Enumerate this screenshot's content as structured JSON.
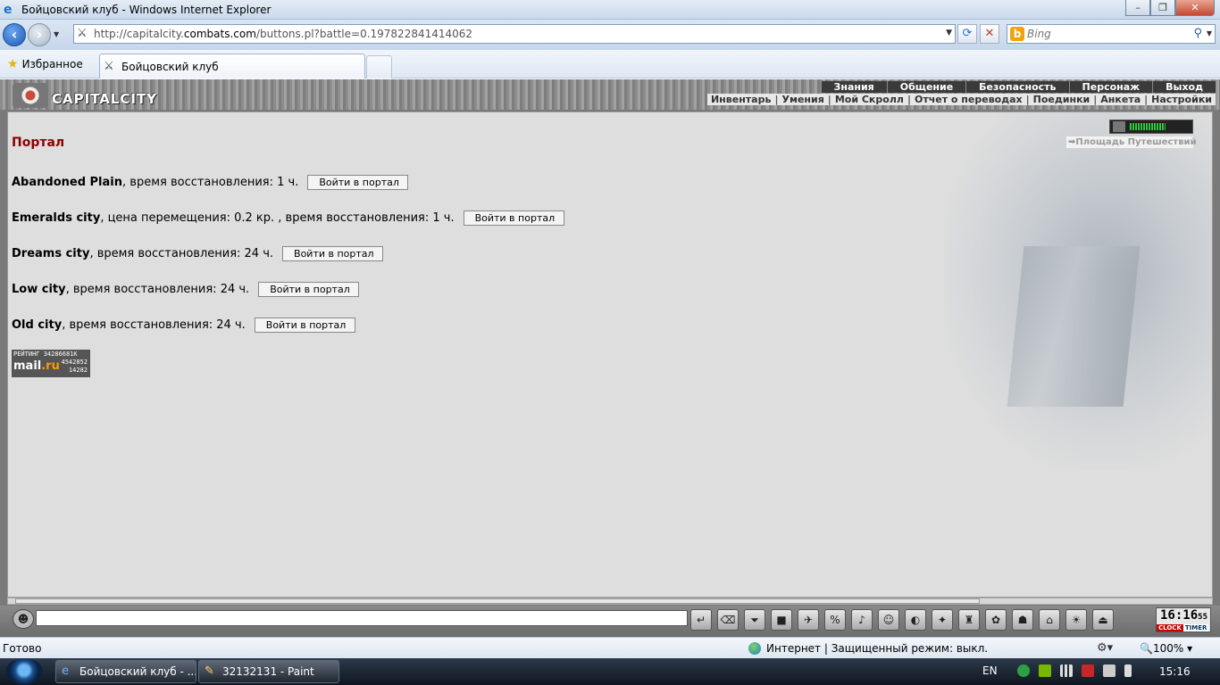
{
  "window": {
    "title": "Бойцовский клуб - Windows Internet Explorer",
    "buttons": [
      "–",
      "❐",
      "✕"
    ]
  },
  "address": {
    "url_prefix": "http://capitalcity.",
    "url_domain": "combats.com",
    "url_suffix": "/buttons.pl?battle=0.197822841414062",
    "search_placeholder": "Bing"
  },
  "tabs": {
    "favorites_label": "Избранное",
    "active_tab_label": "Бойцовский клуб"
  },
  "game": {
    "logo_text": "CAPITALCITY",
    "top_menu": [
      "Знания",
      "Общение",
      "Безопасность",
      "Персонаж",
      "Выход"
    ],
    "sub_menu": [
      "Инвентарь",
      "Умения",
      "Мой Скролл",
      "Отчет о переводах",
      "Поединки",
      "Анкета",
      "Настройки"
    ],
    "travel_link": "Площадь Путешествий"
  },
  "portal": {
    "title": "Портал",
    "button_label": "Войти в портал",
    "destinations": [
      {
        "name": "Abandoned Plain",
        "details": ", время восстановления: 1 ч."
      },
      {
        "name": "Emeralds city",
        "details": ", цена перемещения: 0.2 кр. , время восстановления: 1 ч."
      },
      {
        "name": "Dreams city",
        "details": ", время восстановления: 24 ч."
      },
      {
        "name": "Low city",
        "details": ", время восстановления: 24 ч."
      },
      {
        "name": "Old city",
        "details": ", время восстановления: 24 ч."
      }
    ]
  },
  "counter": {
    "header": "РЕЙТИНГ 34286681K",
    "brand_a": "mail",
    "brand_b": ".ru",
    "n1": "4542852",
    "n2": "14282"
  },
  "clock": {
    "time": "16:16",
    "sec": "55",
    "clock_label": "CLOCK",
    "timer_label": "TIMER"
  },
  "status": {
    "ready": "Готово",
    "zone": "Интернет | Защищенный режим: выкл.",
    "zoom": "100%"
  },
  "taskbar": {
    "tasks": [
      "Бойцовский клуб - ...",
      "32132131 - Paint"
    ],
    "lang": "EN",
    "time": "15:16"
  }
}
